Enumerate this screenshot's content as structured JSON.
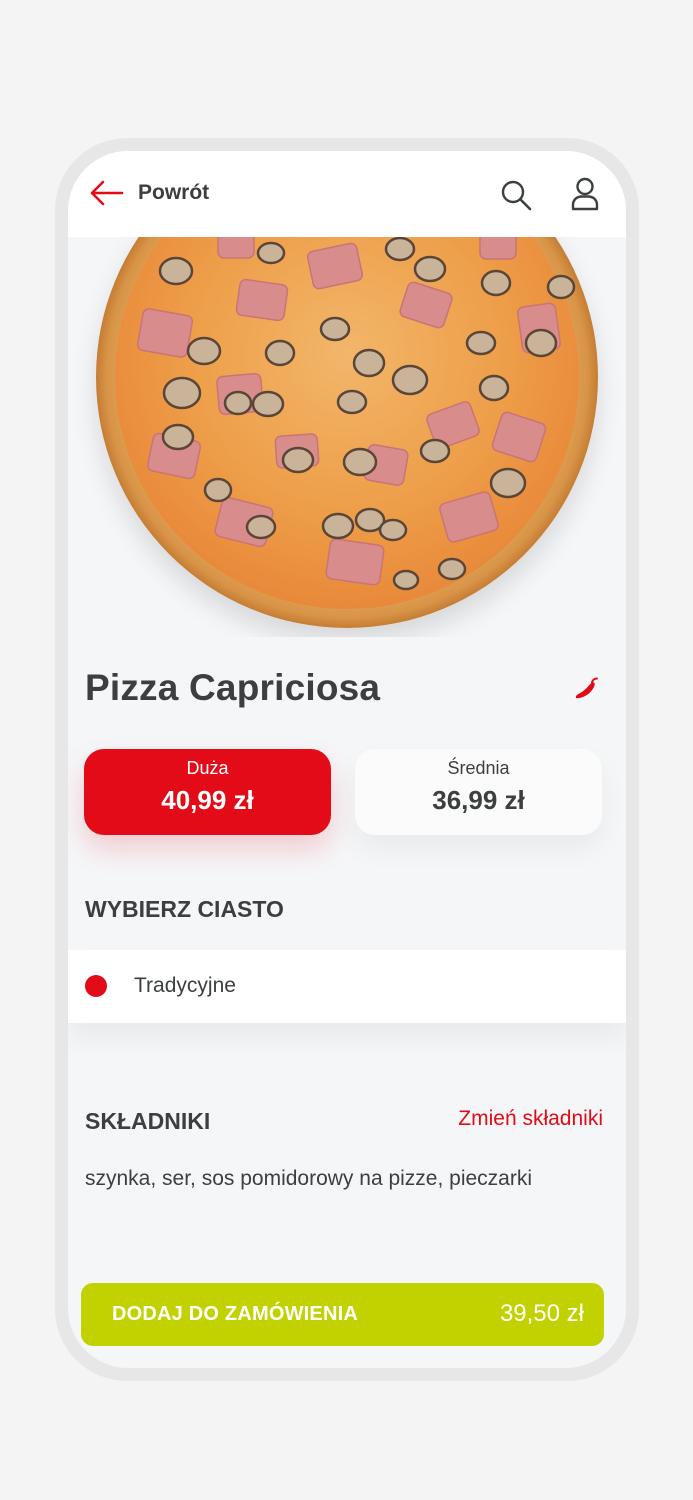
{
  "header": {
    "back_label": "Powrót",
    "icons": [
      "back-arrow-icon",
      "search-icon",
      "user-icon"
    ]
  },
  "product": {
    "title": "Pizza Capriciosa",
    "spicy_icon": "chili-icon"
  },
  "sizes": [
    {
      "name": "Duża",
      "price": "40,99 zł",
      "selected": true
    },
    {
      "name": "Średnia",
      "price": "36,99 zł",
      "selected": false
    }
  ],
  "dough": {
    "heading": "WYBIERZ CIASTO",
    "options": [
      {
        "label": "Tradycyjne",
        "selected": true
      }
    ]
  },
  "ingredients": {
    "heading": "SKŁADNIKI",
    "change_link": "Zmień składniki",
    "list": "szynka, ser, sos pomidorowy na pizze, pieczarki"
  },
  "add_to_order": {
    "label": "DODAJ DO ZAMÓWIENIA",
    "price": "39,50 zł"
  },
  "colors": {
    "accent": "#e30b17",
    "cta": "#c2d200",
    "text": "#3b3f40",
    "background": "#f5f6f8"
  }
}
